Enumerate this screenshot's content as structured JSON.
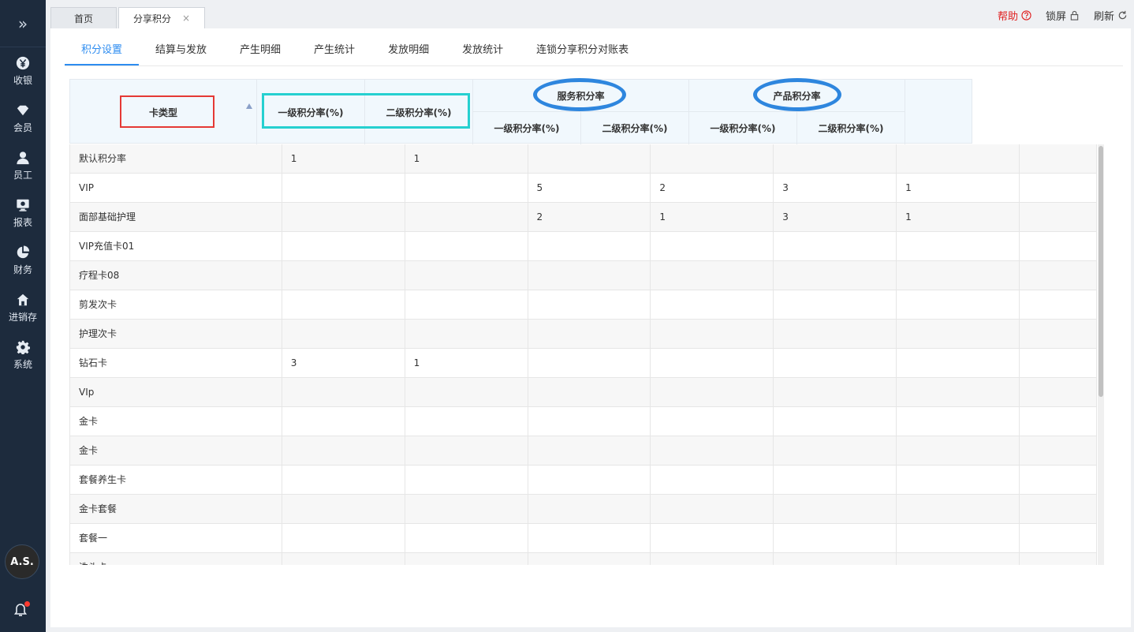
{
  "sidebar": {
    "toggle_icon": "double-chevron-right-icon",
    "items": [
      {
        "label": "收银",
        "icon": "yen-icon"
      },
      {
        "label": "会员",
        "icon": "diamond-icon"
      },
      {
        "label": "员工",
        "icon": "user-icon"
      },
      {
        "label": "报表",
        "icon": "monitor-icon"
      },
      {
        "label": "财务",
        "icon": "pie-icon"
      },
      {
        "label": "进销存",
        "icon": "home-icon"
      },
      {
        "label": "系统",
        "icon": "gear-icon"
      }
    ],
    "avatar": "A.S."
  },
  "tabs": [
    {
      "label": "首页"
    },
    {
      "label": "分享积分",
      "close": "×"
    }
  ],
  "topright": {
    "help": "帮助",
    "lock": "锁屏",
    "refresh": "刷新"
  },
  "subtabs": [
    "积分设置",
    "结算与发放",
    "产生明细",
    "产生统计",
    "发放明细",
    "发放统计",
    "连锁分享积分对账表"
  ],
  "header": {
    "card_type": "卡类型",
    "level1": "一级积分率(%)",
    "level2": "二级积分率(%)",
    "service_group": "服务积分率",
    "product_group": "产品积分率"
  },
  "rows": [
    [
      "默认积分率",
      "1",
      "1",
      "",
      "",
      "",
      ""
    ],
    [
      "VIP",
      "",
      "",
      "5",
      "2",
      "3",
      "1"
    ],
    [
      "面部基础护理",
      "",
      "",
      "2",
      "1",
      "3",
      "1"
    ],
    [
      "VIP充值卡01",
      "",
      "",
      "",
      "",
      "",
      ""
    ],
    [
      "疗程卡08",
      "",
      "",
      "",
      "",
      "",
      ""
    ],
    [
      "剪发次卡",
      "",
      "",
      "",
      "",
      "",
      ""
    ],
    [
      "护理次卡",
      "",
      "",
      "",
      "",
      "",
      ""
    ],
    [
      "钻石卡",
      "3",
      "1",
      "",
      "",
      "",
      ""
    ],
    [
      "VIp",
      "",
      "",
      "",
      "",
      "",
      ""
    ],
    [
      "金卡",
      "",
      "",
      "",
      "",
      "",
      ""
    ],
    [
      "金卡",
      "",
      "",
      "",
      "",
      "",
      ""
    ],
    [
      "套餐养生卡",
      "",
      "",
      "",
      "",
      "",
      ""
    ],
    [
      "金卡套餐",
      "",
      "",
      "",
      "",
      "",
      ""
    ],
    [
      "套餐一",
      "",
      "",
      "",
      "",
      "",
      ""
    ],
    [
      "洗头卡",
      "",
      "",
      "",
      "",
      "",
      ""
    ]
  ],
  "colors": {
    "sidebar_bg": "#1d2b3d",
    "accent": "#2d8cf0",
    "help": "#e02020",
    "annotation_red": "#e53935",
    "annotation_cyan": "#26d0d0",
    "annotation_blue": "#2e86de"
  }
}
